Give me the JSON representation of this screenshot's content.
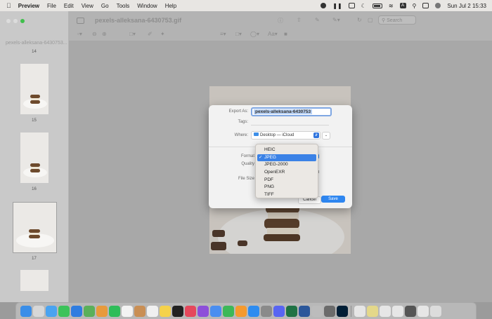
{
  "menubar": {
    "app_name": "Preview",
    "items": [
      "File",
      "Edit",
      "View",
      "Go",
      "Tools",
      "Window",
      "Help"
    ],
    "clock": "Sun Jul 2  15:33",
    "input_indicator": "A"
  },
  "window": {
    "title": "pexels-alleksana-6430753.gif",
    "search_placeholder": "Search"
  },
  "sidebar": {
    "file_label": "pexels-alleksana-6430753...",
    "page_numbers": [
      "14",
      "15",
      "16",
      "17"
    ]
  },
  "dialog": {
    "export_as_label": "Export As:",
    "export_as_value": "pexels-alleksana-6430753",
    "tags_label": "Tags:",
    "where_label": "Where:",
    "where_value": "Desktop — iCloud",
    "format_label": "Format",
    "quality_label": "Quality",
    "file_size_label": "File Size",
    "cancel_label": "Cancel",
    "save_label": "Save"
  },
  "format_menu": {
    "options": [
      "HEIC",
      "JPEG",
      "JPEG-2000",
      "OpenEXR",
      "PDF",
      "PNG",
      "TIFF"
    ],
    "selected": "JPEG"
  },
  "colors": {
    "accent": "#2e86f0",
    "selection": "#3b82e6"
  }
}
